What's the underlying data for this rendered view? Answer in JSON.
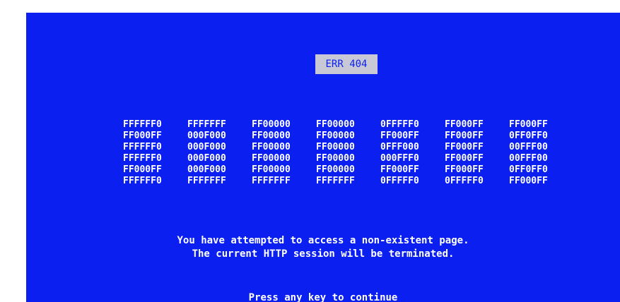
{
  "screen": {
    "background_color": "#0a1ff0",
    "error_code": "ERR 404",
    "hex_rows": [
      [
        "FFFFFF0",
        "FFFFFFF",
        "FF00000",
        "FF00000",
        "0FFFFF0",
        "FF000FF",
        "FF000FF"
      ],
      [
        "FF000FF",
        "000F000",
        "FF00000",
        "FF00000",
        "FF000FF",
        "FF000FF",
        "0FF0FF0"
      ],
      [
        "FFFFFF0",
        "000F000",
        "FF00000",
        "FF00000",
        "0FFF000",
        "FF000FF",
        "00FFF00"
      ],
      [
        "FFFFFF0",
        "000F000",
        "FF00000",
        "FF00000",
        "000FFF0",
        "FF000FF",
        "00FFF00"
      ],
      [
        "FF000FF",
        "000F000",
        "FF00000",
        "FF00000",
        "FF000FF",
        "FF000FF",
        "0FF0FF0"
      ],
      [
        "FFFFFF0",
        "FFFFFFF",
        "FFFFFFF",
        "FFFFFFF",
        "0FFFFF0",
        "0FFFFF0",
        "FF000FF"
      ]
    ],
    "message_line_1": "You have attempted to access a non-existent page.",
    "message_line_2": "The current HTTP session will be terminated.",
    "continue_prompt": "Press any key to continue"
  }
}
